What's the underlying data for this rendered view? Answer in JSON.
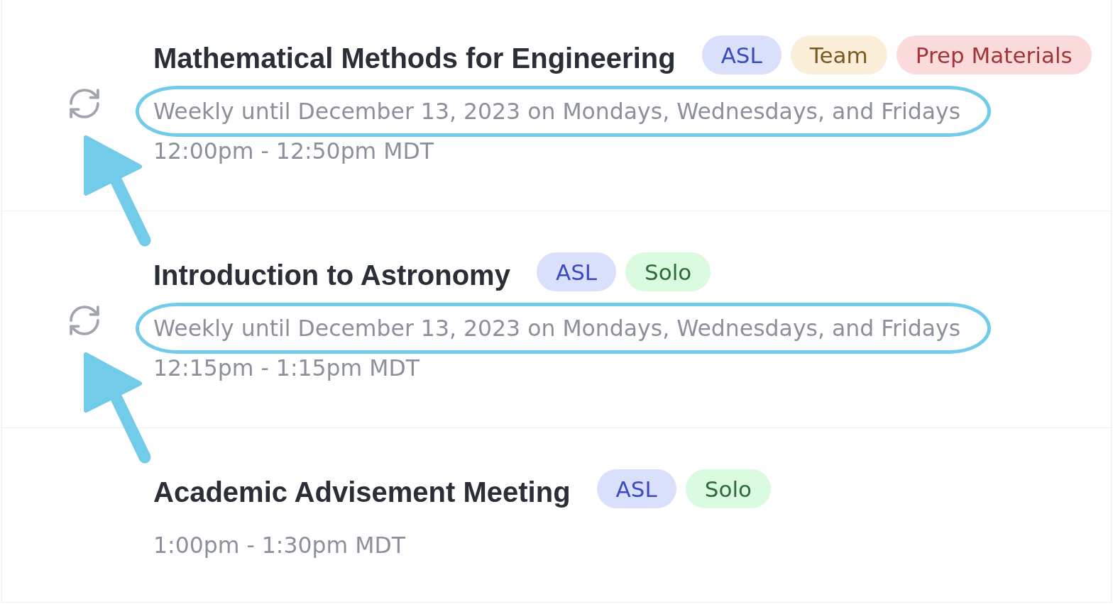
{
  "events": [
    {
      "title": "Mathematical Methods for Engineering",
      "tags": [
        {
          "label": "ASL",
          "color": "#3a4bc0"
        },
        {
          "label": "Team",
          "color": "#7a5a20"
        },
        {
          "label": "Prep Materials",
          "color": "#a2353a"
        }
      ],
      "recurrence": {
        "text": "Weekly until December 13, 2023 on Mondays, Wednesdays, and Fridays",
        "highlighted": true
      },
      "time": "12:00pm - 12:50pm MDT"
    },
    {
      "title": "Introduction to Astronomy",
      "tags": [
        {
          "label": "ASL",
          "color": "#3a4bc0"
        },
        {
          "label": "Solo",
          "color": "#2f6a3a"
        }
      ],
      "recurrence": {
        "text": "Weekly until December 13, 2023 on Mondays, Wednesdays, and Fridays",
        "highlighted": true
      },
      "time": "12:15pm - 1:15pm MDT"
    },
    {
      "title": "Academic Advisement Meeting",
      "tags": [
        {
          "label": "ASL",
          "color": "#3a4bc0"
        },
        {
          "label": "Solo",
          "color": "#2f6a3a"
        }
      ],
      "time": "1:00pm - 1:30pm MDT"
    }
  ]
}
